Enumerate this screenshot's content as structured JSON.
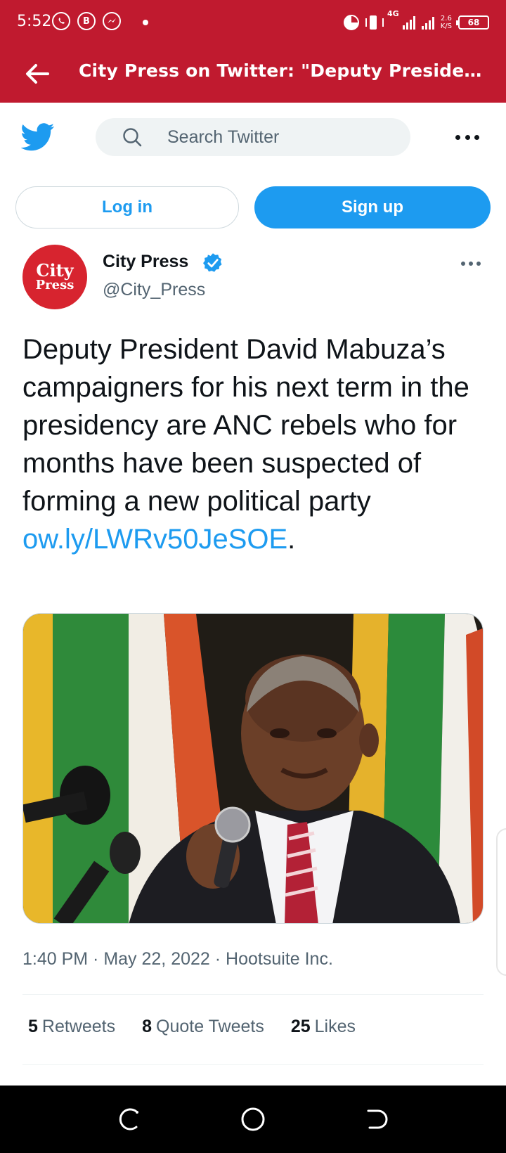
{
  "status_bar": {
    "time": "5:52",
    "notifications": [
      "whatsapp-icon",
      "b-icon",
      "messenger-icon"
    ],
    "network": "4G",
    "speed": "2.6",
    "speed_unit": "K/S",
    "battery": "68"
  },
  "app_bar": {
    "title": "City Press on Twitter: \"Deputy President D...",
    "brand_color": "#c01a2f"
  },
  "header": {
    "search_placeholder": "Search Twitter",
    "login_label": "Log in",
    "signup_label": "Sign up",
    "accent_color": "#1d9bf0"
  },
  "tweet": {
    "avatar_line1": "City",
    "avatar_line2": "Press",
    "display_name": "City Press",
    "handle": "@City_Press",
    "text": "Deputy President David Mabuza’s campaigners for his next term in the presidency are ANC rebels who for months have been suspected of forming a new political party ",
    "link": "ow.ly/LWRv50JeSOE",
    "text_end": ".",
    "time": "1:40 PM",
    "date": "May 22, 2022",
    "source": "Hootsuite Inc.",
    "separator": " · "
  },
  "stats": {
    "retweets_count": "5",
    "retweets_label": "Retweets",
    "quotes_count": "8",
    "quotes_label": "Quote Tweets",
    "likes_count": "25",
    "likes_label": "Likes"
  }
}
